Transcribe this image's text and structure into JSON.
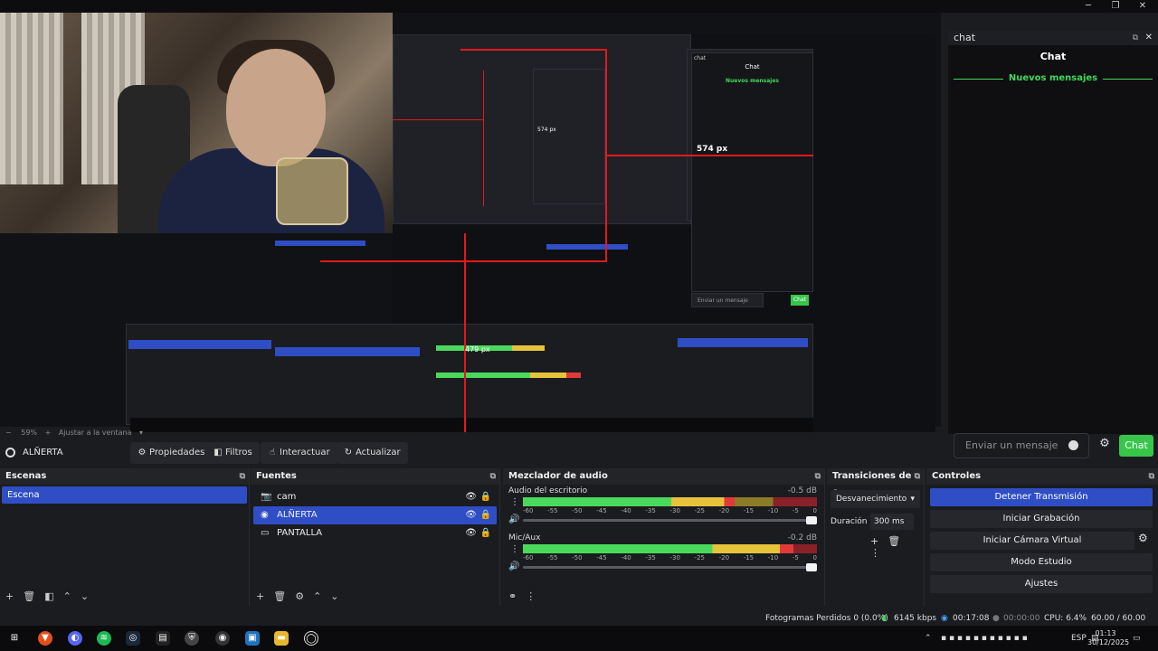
{
  "window_controls": [
    "─",
    "❐",
    "✕"
  ],
  "preview": {
    "nested_labels": {
      "px_574_inner": "574 px",
      "px_574": "574 px",
      "px_479": "479 px",
      "nested_chat": "chat",
      "nested_chat_title": "Chat",
      "nested_new_msgs": "Nuevos mensajes",
      "nested_chat_placeholder": "Enviar un mensaje",
      "nested_chat_send": "Chat"
    },
    "zoom": "59%",
    "fit_label": "Ajustar a la ventana"
  },
  "chat": {
    "header": "chat",
    "title": "Chat",
    "new_messages": "Nuevos mensajes",
    "input_placeholder": "Enviar un mensaje",
    "send_label": "Chat"
  },
  "source_toolbar": {
    "source_name": "ALÑERTA",
    "buttons": [
      "Propiedades",
      "Filtros",
      "Interactuar",
      "Actualizar"
    ]
  },
  "docks": {
    "scenes": {
      "title": "Escenas",
      "items": [
        "Escena"
      ]
    },
    "sources": {
      "title": "Fuentes",
      "items": [
        {
          "name": "cam",
          "selected": false
        },
        {
          "name": "ALÑERTA",
          "selected": true
        },
        {
          "name": "PANTALLA",
          "selected": false
        }
      ]
    },
    "mixer": {
      "title": "Mezclador de audio",
      "channels": [
        {
          "name": "Audio del escritorio",
          "db": "-0.5 dB",
          "level": 0.72
        },
        {
          "name": "Mic/Aux",
          "db": "-0.2 dB",
          "level": 0.92
        }
      ],
      "ticks": [
        "-60",
        "-55",
        "-50",
        "-45",
        "-40",
        "-35",
        "-30",
        "-25",
        "-20",
        "-15",
        "-10",
        "-5",
        "0"
      ]
    },
    "transitions": {
      "title": "Transiciones de e...",
      "selected": "Desvanecimiento",
      "duration_label": "Duración",
      "duration_value": "300 ms"
    },
    "controls": {
      "title": "Controles",
      "buttons": [
        "Detener Transmisión",
        "Iniciar Grabación",
        "Iniciar Cámara Virtual",
        "Modo Estudio",
        "Ajustes"
      ]
    }
  },
  "stats": {
    "dropped": "Fotogramas Perdidos 0 (0.0%)",
    "bitrate": "6145 kbps",
    "stream_time": "00:17:08",
    "rec_time": "00:00:00",
    "cpu": "CPU: 6.4%",
    "fps": "60.00 / 60.00 FPS"
  },
  "taskbar": {
    "lang": "ESP",
    "time": "01:13",
    "date": "30/12/2025"
  },
  "colors": {
    "accent_blue": "#2f4ec5",
    "chat_green": "#42d75a",
    "send_green": "#37c64a",
    "red_guides": "#e2191c"
  }
}
